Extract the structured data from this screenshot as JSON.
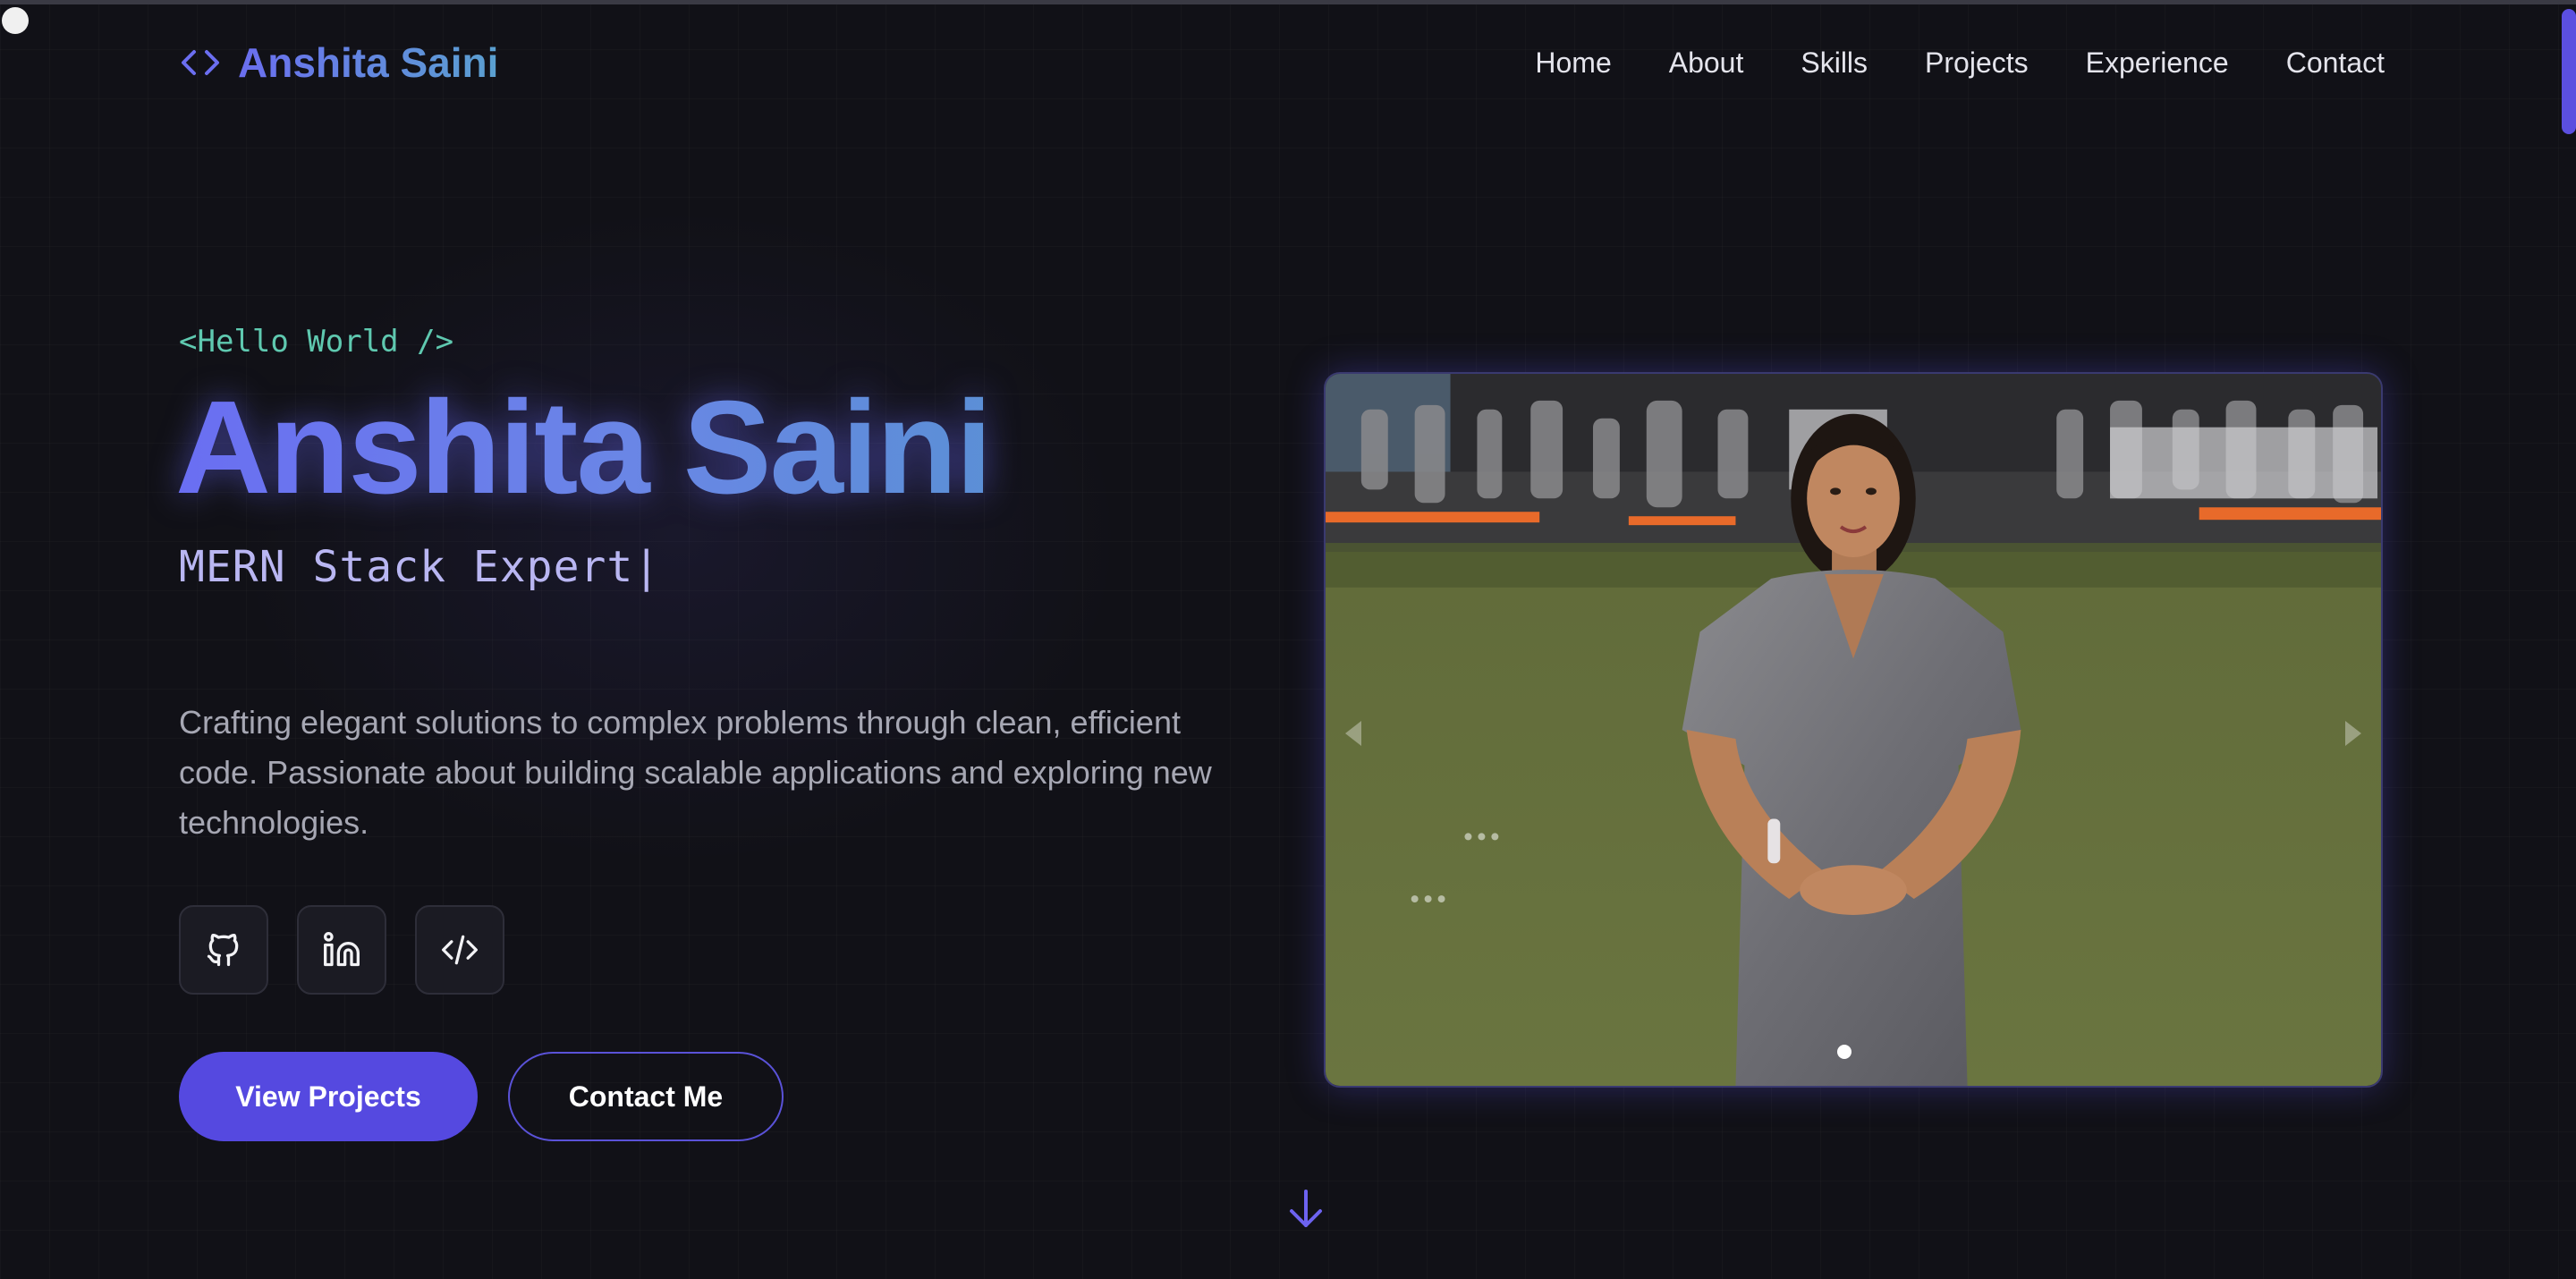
{
  "header": {
    "logo_icon": "code-brackets-icon",
    "logo_text": "Anshita Saini",
    "nav": [
      {
        "label": "Home"
      },
      {
        "label": "About"
      },
      {
        "label": "Skills"
      },
      {
        "label": "Projects"
      },
      {
        "label": "Experience"
      },
      {
        "label": "Contact"
      }
    ]
  },
  "hero": {
    "greeting": "<Hello World />",
    "name": "Anshita Saini",
    "role": "MERN Stack Expert|",
    "description": "Crafting elegant solutions to complex problems through clean, efficient code. Passionate about building scalable applications and exploring new technologies.",
    "socials": [
      {
        "icon": "github-icon"
      },
      {
        "icon": "linkedin-icon"
      },
      {
        "icon": "code-icon"
      }
    ],
    "primary_button": "View Projects",
    "secondary_button": "Contact Me",
    "scroll_icon": "arrow-down-icon"
  },
  "carousel": {
    "image_alt": "Photo of Anshita Saini standing on a grass field at an outdoor event",
    "slide_count": 1,
    "active_slide": 1
  },
  "colors": {
    "background": "#111117",
    "accent": "#5549e0",
    "greeting": "#5fc9b0",
    "role": "#b9b6f2"
  }
}
